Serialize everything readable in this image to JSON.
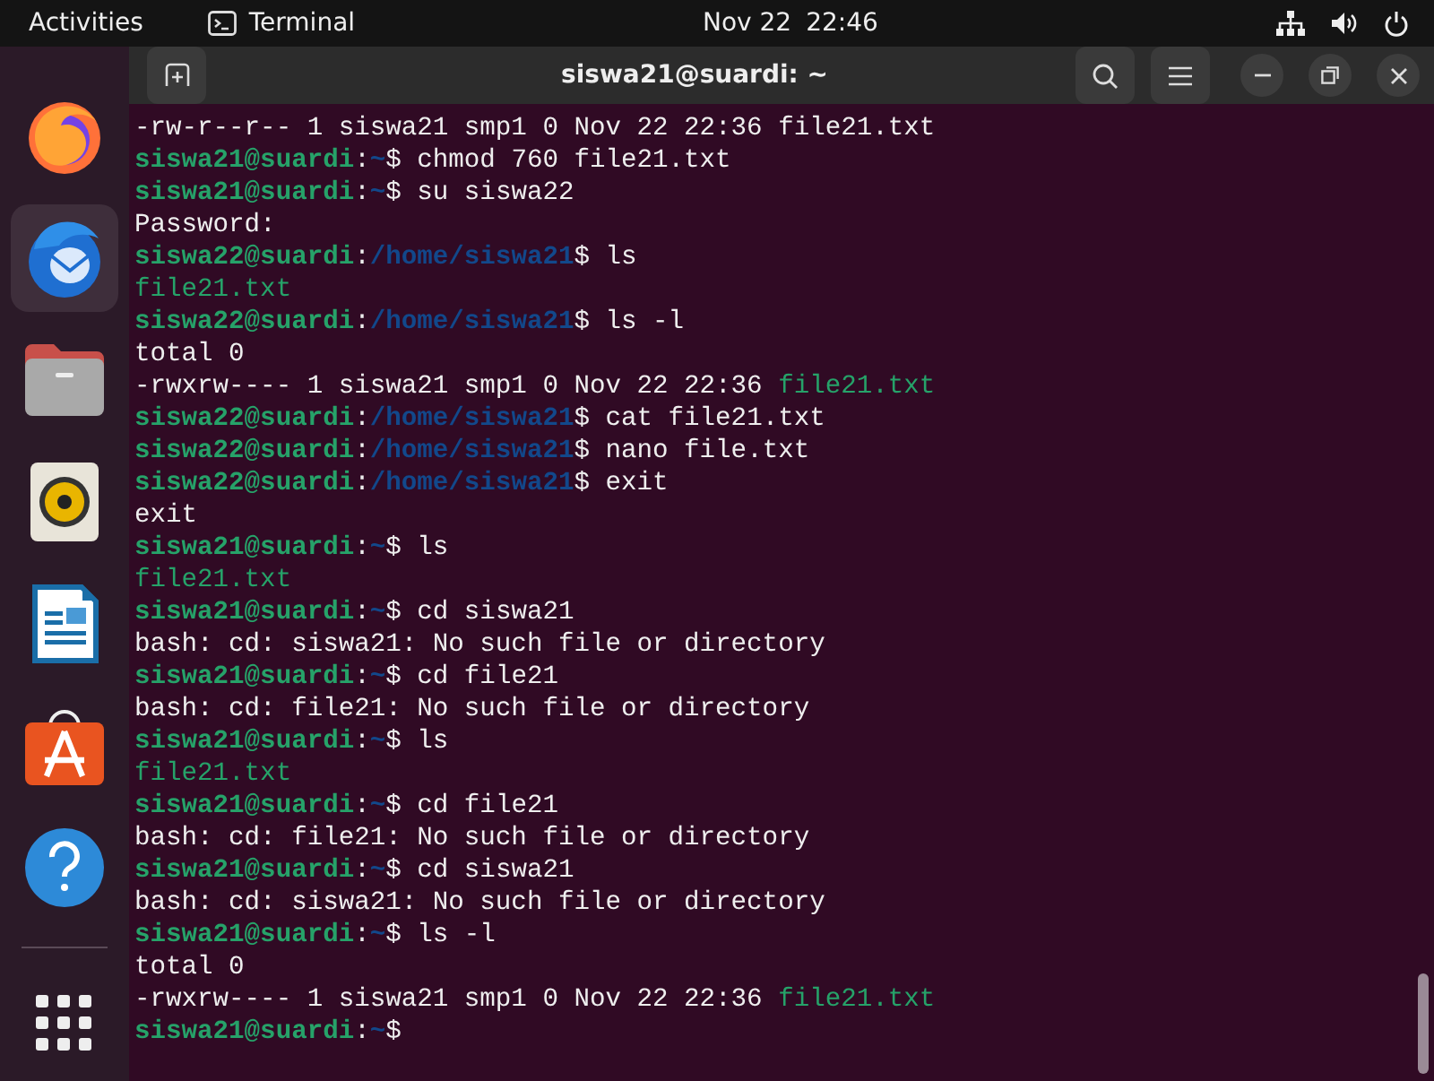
{
  "top_bar": {
    "activities": "Activities",
    "app_menu": "Terminal",
    "date": "Nov 22",
    "time": "22:46"
  },
  "dock": {
    "items": [
      {
        "kind": "firefox",
        "selected": false
      },
      {
        "kind": "thunderbird",
        "selected": true
      },
      {
        "kind": "files",
        "selected": false
      },
      {
        "kind": "rhythmbox",
        "selected": false
      },
      {
        "kind": "writer",
        "selected": false
      },
      {
        "kind": "store",
        "selected": false
      },
      {
        "kind": "help",
        "selected": false
      }
    ]
  },
  "window": {
    "title": "siswa21@suardi: ~"
  },
  "terminal": {
    "lines": [
      {
        "kind": "output",
        "text": "-rw-r--r-- 1 siswa21 smp1 0 Nov 22 22:36 file21.txt"
      },
      {
        "kind": "prompt",
        "user_host": "siswa21@suardi",
        "separator": ":",
        "path": "~",
        "command": "$ chmod 760 file21.txt"
      },
      {
        "kind": "prompt",
        "user_host": "siswa21@suardi",
        "separator": ":",
        "path": "~",
        "command": "$ su siswa22"
      },
      {
        "kind": "output",
        "text": "Password:"
      },
      {
        "kind": "prompt",
        "user_host": "siswa22@suardi",
        "separator": ":",
        "path": "/home/siswa21",
        "command": "$ ls"
      },
      {
        "kind": "file",
        "text": "file21.txt"
      },
      {
        "kind": "prompt",
        "user_host": "siswa22@suardi",
        "separator": ":",
        "path": "/home/siswa21",
        "command": "$ ls -l"
      },
      {
        "kind": "output",
        "text": "total 0"
      },
      {
        "kind": "listing",
        "text": "-rwxrw---- 1 siswa21 smp1 0 Nov 22 22:36 ",
        "file": "file21.txt"
      },
      {
        "kind": "prompt",
        "user_host": "siswa22@suardi",
        "separator": ":",
        "path": "/home/siswa21",
        "command": "$ cat file21.txt"
      },
      {
        "kind": "prompt",
        "user_host": "siswa22@suardi",
        "separator": ":",
        "path": "/home/siswa21",
        "command": "$ nano file.txt"
      },
      {
        "kind": "prompt",
        "user_host": "siswa22@suardi",
        "separator": ":",
        "path": "/home/siswa21",
        "command": "$ exit"
      },
      {
        "kind": "output",
        "text": "exit"
      },
      {
        "kind": "prompt",
        "user_host": "siswa21@suardi",
        "separator": ":",
        "path": "~",
        "command": "$ ls"
      },
      {
        "kind": "file",
        "text": "file21.txt"
      },
      {
        "kind": "prompt",
        "user_host": "siswa21@suardi",
        "separator": ":",
        "path": "~",
        "command": "$ cd siswa21"
      },
      {
        "kind": "output",
        "text": "bash: cd: siswa21: No such file or directory"
      },
      {
        "kind": "prompt",
        "user_host": "siswa21@suardi",
        "separator": ":",
        "path": "~",
        "command": "$ cd file21"
      },
      {
        "kind": "output",
        "text": "bash: cd: file21: No such file or directory"
      },
      {
        "kind": "prompt",
        "user_host": "siswa21@suardi",
        "separator": ":",
        "path": "~",
        "command": "$ ls"
      },
      {
        "kind": "file",
        "text": "file21.txt"
      },
      {
        "kind": "prompt",
        "user_host": "siswa21@suardi",
        "separator": ":",
        "path": "~",
        "command": "$ cd file21"
      },
      {
        "kind": "output",
        "text": "bash: cd: file21: No such file or directory"
      },
      {
        "kind": "prompt",
        "user_host": "siswa21@suardi",
        "separator": ":",
        "path": "~",
        "command": "$ cd siswa21"
      },
      {
        "kind": "output",
        "text": "bash: cd: siswa21: No such file or directory"
      },
      {
        "kind": "prompt",
        "user_host": "siswa21@suardi",
        "separator": ":",
        "path": "~",
        "command": "$ ls -l"
      },
      {
        "kind": "output",
        "text": "total 0"
      },
      {
        "kind": "listing",
        "text": "-rwxrw---- 1 siswa21 smp1 0 Nov 22 22:36 ",
        "file": "file21.txt"
      },
      {
        "kind": "prompt",
        "user_host": "siswa21@suardi",
        "separator": ":",
        "path": "~",
        "command": "$"
      }
    ]
  }
}
